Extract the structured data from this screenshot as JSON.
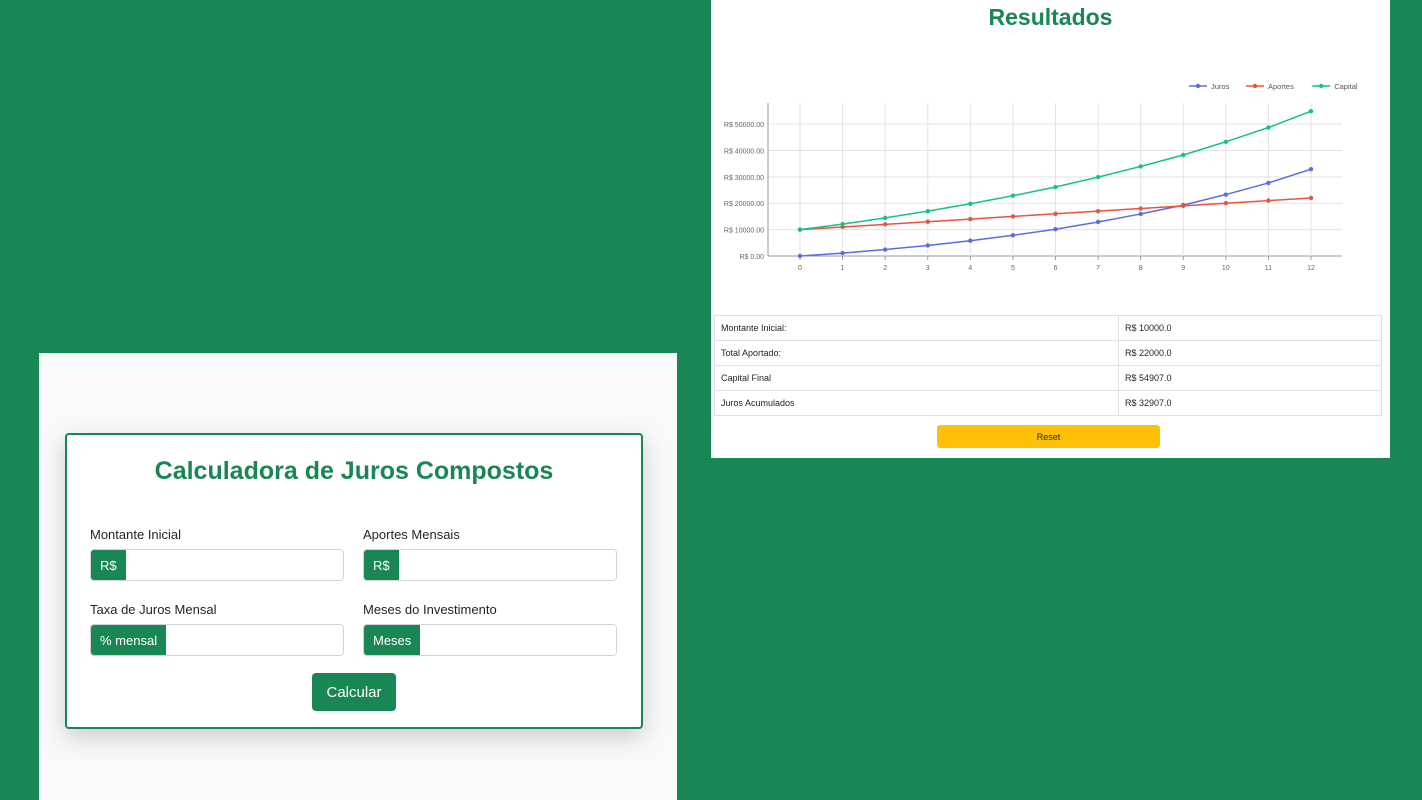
{
  "calculator": {
    "title": "Calculadora de Juros Compostos",
    "fields": [
      {
        "label": "Montante Inicial",
        "addon": "R$",
        "value": ""
      },
      {
        "label": "Aportes Mensais",
        "addon": "R$",
        "value": ""
      },
      {
        "label": "Taxa de Juros Mensal",
        "addon": "% mensal",
        "value": ""
      },
      {
        "label": "Meses do Investimento",
        "addon": "Meses",
        "value": ""
      }
    ],
    "submit_label": "Calcular"
  },
  "results": {
    "title": "Resultados",
    "table": [
      {
        "label": "Montante Inicial:",
        "value": "R$ 10000.0"
      },
      {
        "label": "Total Aportado:",
        "value": "R$ 22000.0"
      },
      {
        "label": "Capital Final",
        "value": "R$ 54907.0"
      },
      {
        "label": "Juros Acumulados",
        "value": "R$ 32907.0"
      }
    ],
    "reset_label": "Reset"
  },
  "colors": {
    "brand": "#198754",
    "reset": "#ffc107",
    "juros": "#5b6ee1",
    "aportes": "#e8553e",
    "capital": "#17c08a"
  },
  "chart_data": {
    "type": "line",
    "x": [
      0,
      1,
      2,
      3,
      4,
      5,
      6,
      7,
      8,
      9,
      10,
      11,
      12
    ],
    "yticks": [
      "R$ 0.00",
      "R$ 10000.00",
      "R$ 20000.00",
      "R$ 30000.00",
      "R$ 40000.00",
      "R$ 50000.00"
    ],
    "ylim": [
      0,
      58000
    ],
    "grid": true,
    "legend": "top-right",
    "series": [
      {
        "name": "Juros",
        "color": "#5b6ee1",
        "values": [
          0,
          1100,
          2450,
          4000,
          5800,
          7850,
          10150,
          12900,
          15950,
          19300,
          23300,
          27700,
          32907
        ]
      },
      {
        "name": "Aportes",
        "color": "#e8553e",
        "values": [
          10000,
          11000,
          12000,
          13000,
          14000,
          15000,
          16000,
          17000,
          18000,
          19000,
          20000,
          21000,
          22000
        ]
      },
      {
        "name": "Capital",
        "color": "#17c08a",
        "values": [
          10000,
          12100,
          14450,
          17000,
          19800,
          22850,
          26150,
          29900,
          33950,
          38300,
          43300,
          48700,
          54907
        ]
      }
    ]
  }
}
